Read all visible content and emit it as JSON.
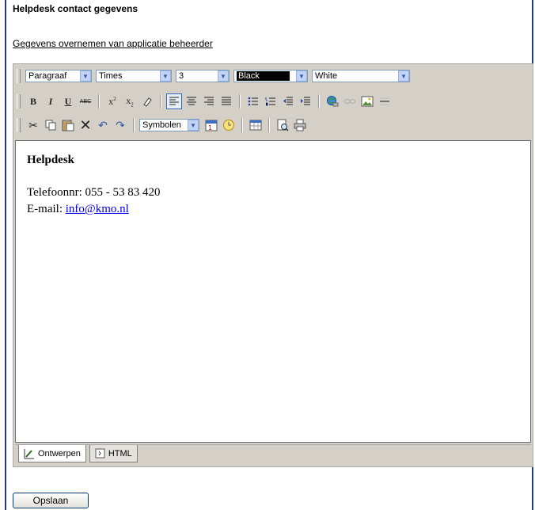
{
  "page": {
    "title": "Helpdesk contact gegevens",
    "copy_link": "Gegevens overnemen van applicatie beheerder"
  },
  "toolbar": {
    "paragraph": "Paragraaf",
    "font": "Times",
    "size": "3",
    "fore_color": "Black",
    "back_color": "White",
    "symbols": "Symbolen",
    "bold": "B",
    "italic": "I",
    "underline": "U",
    "strike": "ABC"
  },
  "content": {
    "heading": "Helpdesk",
    "phone": "Telefoonnr: 055 - 53 83 420",
    "email_label": "E-mail: ",
    "email_link": "info@kmo.nl"
  },
  "tabs": [
    {
      "label": "Ontwerpen"
    },
    {
      "label": "HTML"
    }
  ],
  "save_label": "Opslaan"
}
